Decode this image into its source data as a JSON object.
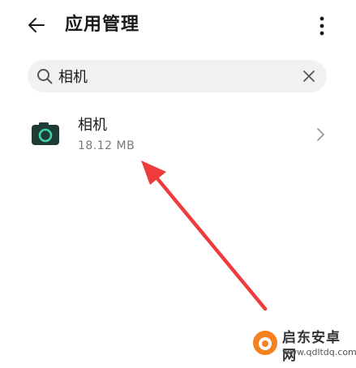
{
  "header": {
    "title": "应用管理",
    "back_icon": "arrow-left-icon",
    "more_icon": "more-vertical-icon"
  },
  "search": {
    "value": "相机",
    "placeholder": "",
    "search_icon": "search-icon",
    "clear_icon": "close-icon"
  },
  "results": [
    {
      "name": "相机",
      "size": "18.12 MB",
      "icon": "camera-icon"
    }
  ],
  "annotation": {
    "color": "#ee3b3b"
  },
  "watermark": {
    "title": "启东安卓网",
    "url": "www.qdltdq.com",
    "logo_color": "#f58220"
  }
}
